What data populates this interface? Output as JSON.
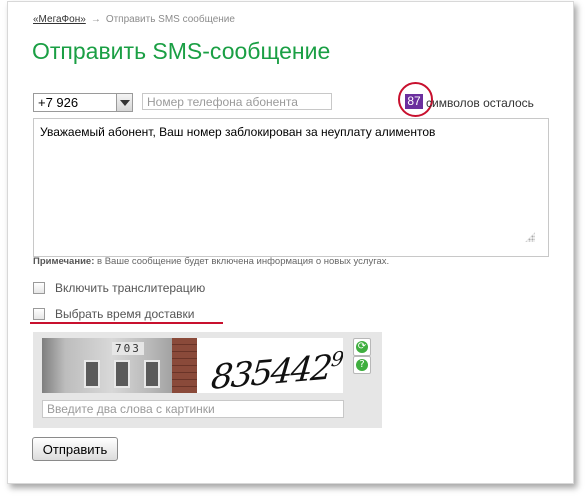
{
  "breadcrumb": {
    "home": "«МегаФон»",
    "arrow": "→",
    "current": "Отправить SMS сообщение"
  },
  "page_title": "Отправить SMS-сообщение",
  "phone": {
    "prefix": "+7 926",
    "placeholder": "Номер телефона абонента"
  },
  "counter": {
    "value": "87",
    "label": "символов осталось"
  },
  "message": {
    "text": "Уважаемый абонент, Ваш номер заблокирован за неуплату алиментов"
  },
  "note": {
    "bold": "Примечание:",
    "text": " в Ваше сообщение будет включена информация о новых услугах."
  },
  "options": [
    {
      "label": "Включить транслитерацию",
      "checked": false
    },
    {
      "label": "Выбрать время доставки",
      "checked": false
    }
  ],
  "captcha": {
    "house_number": "703",
    "word": "835442",
    "word_sup": "9",
    "refresh_icon": "⟳",
    "help_icon": "?",
    "placeholder": "Введите два слова с картинки"
  },
  "submit_label": "Отправить",
  "colors": {
    "title": "#1a9f44",
    "highlight": "#c8102e",
    "counter_bg": "#6b2f9e"
  },
  "icons": [
    "dropdown-arrow-icon",
    "refresh-icon",
    "help-icon",
    "resize-grip-icon"
  ]
}
